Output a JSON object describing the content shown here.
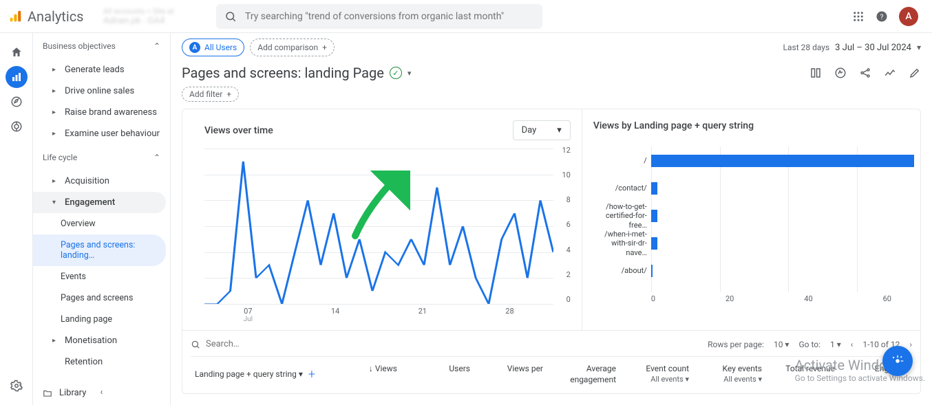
{
  "header": {
    "product": "Analytics",
    "account_line1": "All accounts > Site at",
    "account_line2": "Adnan.pk - GA4",
    "search_placeholder": "Try searching \"trend of conversions from organic last month\"",
    "avatar_letter": "A"
  },
  "sidebar": {
    "group1_label": "Business objectives",
    "g1_items": [
      "Generate leads",
      "Drive online sales",
      "Raise brand awareness",
      "Examine user behaviour"
    ],
    "group2_label": "Life cycle",
    "acquisition": "Acquisition",
    "engagement": "Engagement",
    "eng_items": [
      "Overview",
      "Pages and screens: landing…",
      "Events",
      "Pages and screens",
      "Landing page"
    ],
    "monetisation": "Monetisation",
    "retention": "Retention",
    "library": "Library"
  },
  "toolbar": {
    "all_users": "All Users",
    "add_comparison": "Add comparison",
    "date_label": "Last 28 days",
    "date_value": "3 Jul – 30 Jul 2024"
  },
  "title": "Pages and screens: landing Page",
  "add_filter": "Add filter",
  "chart_left_title": "Views over time",
  "granularity": "Day",
  "chart_right_title": "Views by Landing page + query string",
  "chart_data": {
    "line": {
      "type": "line",
      "title": "Views over time",
      "ylabel": "",
      "xlabel": "",
      "ylim": [
        0,
        12
      ],
      "yticks": [
        0,
        2,
        4,
        6,
        8,
        10,
        12
      ],
      "x_start": "2024-07-03",
      "x_end": "2024-07-30",
      "xticks": [
        "07",
        "14",
        "21",
        "28"
      ],
      "xtick_sub": "Jul",
      "values": [
        0,
        0,
        1,
        11,
        2,
        3,
        0,
        4,
        8,
        3,
        7,
        2,
        5,
        1,
        4,
        3,
        5,
        3,
        9,
        3,
        6,
        2,
        0,
        5,
        7,
        2,
        8,
        4
      ]
    },
    "bar": {
      "type": "bar",
      "title": "Views by Landing page + query string",
      "xlim": [
        0,
        70
      ],
      "xticks": [
        0,
        20,
        40,
        60
      ],
      "categories": [
        "/",
        "/contact/",
        "/how-to-get-certified-for-free…",
        "/when-i-met-with-sir-dr-nave…",
        "/about/"
      ],
      "values": [
        62,
        3,
        3,
        3,
        2
      ]
    }
  },
  "table": {
    "search_placeholder": "Search…",
    "rows_label": "Rows per page:",
    "rows_value": "10",
    "goto_label": "Go to:",
    "goto_value": "1",
    "range": "1-10 of 12",
    "dim_label": "Landing page + query string",
    "metrics": [
      {
        "label": "Views",
        "sort": true
      },
      {
        "label": "Users"
      },
      {
        "label": "Views per"
      },
      {
        "label": "Average engagement"
      },
      {
        "label": "Event count",
        "sub": "All events"
      },
      {
        "label": "Key events",
        "sub": "All events"
      },
      {
        "label": "Total revenue"
      },
      {
        "label": "Eng sess"
      }
    ]
  },
  "watermark": {
    "line1": "Activate Windows",
    "line2": "Go to Settings to activate Windows."
  }
}
